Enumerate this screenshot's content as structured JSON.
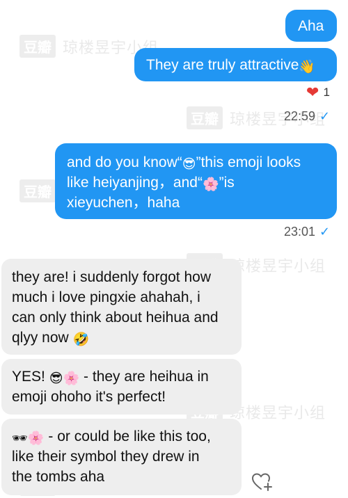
{
  "watermark": {
    "logo": "豆瓣",
    "text": "琼楼昱宇小组"
  },
  "messages": {
    "m1": {
      "text": "Aha"
    },
    "m2": {
      "text": "They are truly attractive",
      "emoji": "👋"
    },
    "reaction": {
      "icon": "❤",
      "count": "1"
    },
    "time1": "22:59",
    "m3": {
      "line1_a": "and do you know“",
      "line1_emoji": "😎",
      "line1_b": "”this emoji looks",
      "line2_a": "like heiyanjing，and“",
      "line2_emoji": "🌸",
      "line2_b": "”is",
      "line3": "xieyuchen，haha"
    },
    "time2": "23:01",
    "m4": {
      "line1": "they are! i suddenly forgot how",
      "line2": "much i love pingxie ahahah, i",
      "line3": "can only think about heihua and",
      "line4_a": "qlyy now",
      "line4_emoji": "🤣"
    },
    "m5": {
      "a": "YES!",
      "emoji1": "😎",
      "emoji2": "🌸",
      "b": "- they are heihua in",
      "line2": "emoji ohoho it's perfect!"
    },
    "m6": {
      "emoji1": "🕶",
      "emoji2": "🌸",
      "a": "- or could be like this too,",
      "line2": "like their symbol they drew in",
      "line3": "the tombs aha"
    }
  },
  "check_icon": "✓",
  "colors": {
    "outgoing": "#2196f3",
    "incoming": "#eeeeee",
    "heart": "#e53935"
  }
}
